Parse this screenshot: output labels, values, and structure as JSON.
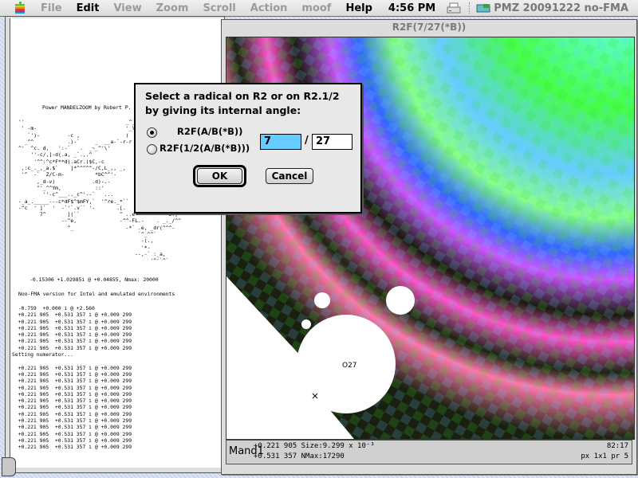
{
  "menubar": {
    "apple_icon": "apple-logo-icon",
    "items": [
      {
        "label": "File",
        "enabled": false
      },
      {
        "label": "Edit",
        "enabled": true
      },
      {
        "label": "View",
        "enabled": false
      },
      {
        "label": "Zoom",
        "enabled": false
      },
      {
        "label": "Scroll",
        "enabled": false
      },
      {
        "label": "Action",
        "enabled": false
      },
      {
        "label": "moof",
        "enabled": false
      },
      {
        "label": "Help",
        "enabled": true
      }
    ],
    "clock": "4:56 PM",
    "printer_icon": "printer-icon",
    "app_name": "PMZ 20091222 no-FMA"
  },
  "text_window": {
    "header": "Power MANDELZOOM by Robert P. M",
    "ascii_art": [
      "''                                 _^_",
      " ' -m-                             '_\\'",
      "   `')-         -c ,               (",
      "  _^^           .)-`     _  __a-`-r-r",
      "^'  ^c. d,   ':-`   .  _~_^'\\'",
      "    ''-c/,]-d(.a, _`.,.^",
      "     '^^:^c*F**d).aCr.)$C,-c",
      " ,:c_._,_a.$`    ]*^^^^^-/C,L_,, _,",
      " '^  -`  Z/C-m-          *bC^^'-",
      "      ,_d-v)            .d)-.-",
      "      ^'_^^Ym,           ::'",
      "        ''-c^___.._c^'--`   ...",
      "-_a_._____---c*dF$^$mFY,`  '^re._*``",
      "-^c  ' ]`  '  -`'`.v`` '-       .[.",
      "       7^       ](``             ^ ..e          `L.,",
      "              --^e,              -^^-FL.-    . _._/^^",
      "                ^_                 -*` .e, _dr(^^^-",
      "                                       `^_^^`",
      "                                        -(.,",
      "                                        '*-",
      "                                      --,-` :_a,",
      "                                           '^'`^`"
    ],
    "coords_line": "-0.15306 +1.02985i @ +0.04855, Nmax: 20000",
    "version_line": "Non-FMA version for Intel and emulated environments",
    "initial_line": "  -0.759  +0.000 i @ +2.560",
    "repeat_line": "  +0.221 905  +0.531 357 i @ +0.009 299",
    "lines_before": 6,
    "setting_line": "Setting numerator...",
    "lines_after": 13
  },
  "fractal_window": {
    "title": "R2F(7/27(*B))",
    "marker_label": "O27",
    "status": {
      "name": "Mand1",
      "line1": "+0.221 905 Size:9.299 x 10⁻³",
      "line2": "+0.531 357 NMax:17290",
      "right1": "82:17",
      "right2": "px 1x1   pr 5"
    }
  },
  "dialog": {
    "prompt": "Select a radical on R2 or on R2.1/2 by giving its internal angle:",
    "options": [
      {
        "label": "R2F(A/B(*B))",
        "checked": true
      },
      {
        "label": "R2F(1/2(A/B(*B)))",
        "checked": false
      }
    ],
    "numerator": "7",
    "separator": "/",
    "denominator": "27",
    "ok_label": "OK",
    "cancel_label": "Cancel"
  }
}
